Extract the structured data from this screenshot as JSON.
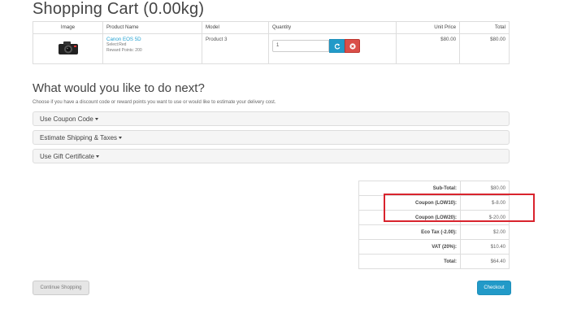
{
  "page": {
    "title": "Shopping Cart  (0.00kg)"
  },
  "cart": {
    "headers": {
      "image": "Image",
      "name": "Product Name",
      "model": "Model",
      "quantity": "Quantity",
      "unit_price": "Unit Price",
      "total": "Total"
    },
    "item": {
      "name": "Canon EOS 5D",
      "option": "Select:Red",
      "reward": "Reward Points: 200",
      "model": "Product 3",
      "quantity": "1",
      "unit_price": "$80.00",
      "total": "$80.00",
      "image_icon": "camera-icon"
    },
    "update_icon": "refresh-icon",
    "remove_icon": "remove-icon"
  },
  "next": {
    "title": "What would you like to do next?",
    "subtitle": "Choose if you have a discount code or reward points you want to use or would like to estimate your delivery cost.",
    "panels": [
      "Use Coupon Code",
      "Estimate Shipping & Taxes",
      "Use Gift Certificate"
    ]
  },
  "totals": [
    {
      "label": "Sub-Total:",
      "value": "$80.00"
    },
    {
      "label": "Coupon (LOW10):",
      "value": "$-8.00"
    },
    {
      "label": "Coupon (LOW20):",
      "value": "$-20.00"
    },
    {
      "label": "Eco Tax (-2.00):",
      "value": "$2.00"
    },
    {
      "label": "VAT (20%):",
      "value": "$10.40"
    },
    {
      "label": "Total:",
      "value": "$64.40"
    }
  ],
  "buttons": {
    "continue": "Continue Shopping",
    "checkout": "Checkout"
  },
  "colors": {
    "accent": "#229ac8",
    "danger": "#da4f49",
    "highlight": "#d9232d",
    "link": "#23a1d1"
  }
}
